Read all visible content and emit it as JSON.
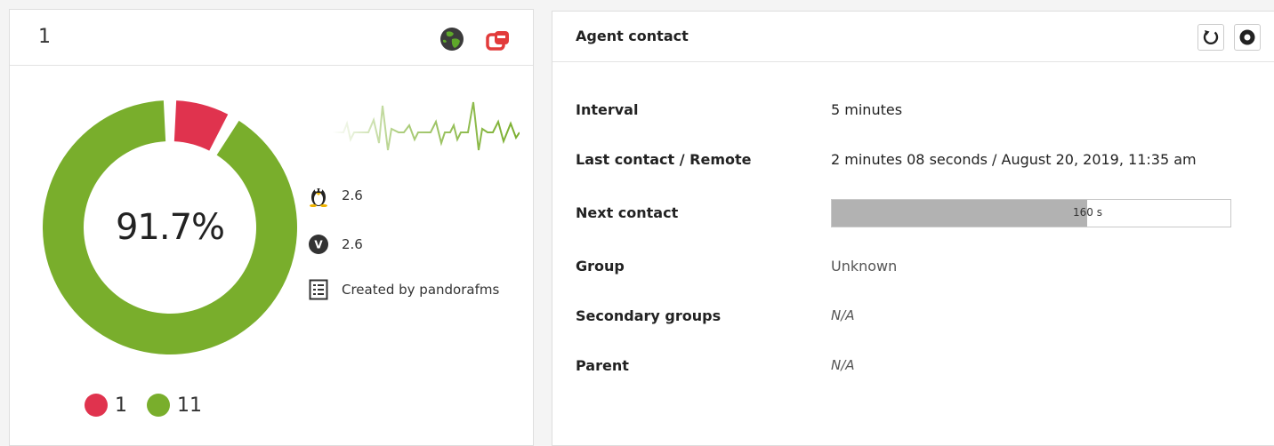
{
  "agent": {
    "name": "1",
    "status_percent": "91.7%",
    "modules": {
      "critical": 1,
      "normal": 11,
      "critical_label": "1",
      "normal_label": "11"
    },
    "info": {
      "os_version": "2.6",
      "agent_version": "2.6",
      "description": "Created by pandorafms"
    },
    "icons": {
      "globe": "globe-icon",
      "remote": "remote-config-icon",
      "os": "linux-tux-icon",
      "agent_version": "agent-version-icon",
      "description": "description-list-icon",
      "refresh": "refresh-icon",
      "force": "force-contact-icon"
    }
  },
  "colors": {
    "critical": "#e0334e",
    "normal": "#79ae2c",
    "bar_fill": "#b2b2b2",
    "remote_icon": "#e23b3b"
  },
  "contact": {
    "title": "Agent contact",
    "rows": [
      {
        "label": "Interval",
        "value": "5 minutes"
      },
      {
        "label": "Last contact / Remote",
        "value": "2 minutes 08 seconds / August 20, 2019, 11:35 am"
      },
      {
        "label": "Next contact",
        "value": "160 s",
        "progress": 0.64
      },
      {
        "label": "Group",
        "value": "Unknown"
      },
      {
        "label": "Secondary groups",
        "value": "N/A"
      },
      {
        "label": "Parent",
        "value": "N/A"
      }
    ]
  }
}
